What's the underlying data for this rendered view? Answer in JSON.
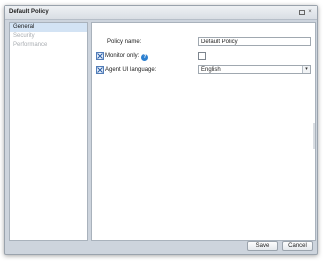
{
  "window": {
    "title": "Default Policy",
    "restore_label": "restore",
    "close_symbol": "×"
  },
  "sidebar": {
    "items": [
      {
        "label": "General",
        "state": "active"
      },
      {
        "label": "Security",
        "state": "disabled"
      },
      {
        "label": "Performance",
        "state": "disabled"
      }
    ]
  },
  "form": {
    "policy_name_label": "Policy name:",
    "policy_name_value": "Default Policy",
    "monitor_only_label": "Monitor only:",
    "help_symbol": "?",
    "monitor_only_checked": false,
    "agent_language_label": "Agent UI language:",
    "agent_language_value": "English",
    "dropdown_symbol": "▾"
  },
  "footer": {
    "save_label": "Save",
    "cancel_label": "Cancel"
  },
  "colors": {
    "accent": "#2b7fd0",
    "selected_bg": "#d3e3f4",
    "frame_bg": "#cdd4dd"
  }
}
